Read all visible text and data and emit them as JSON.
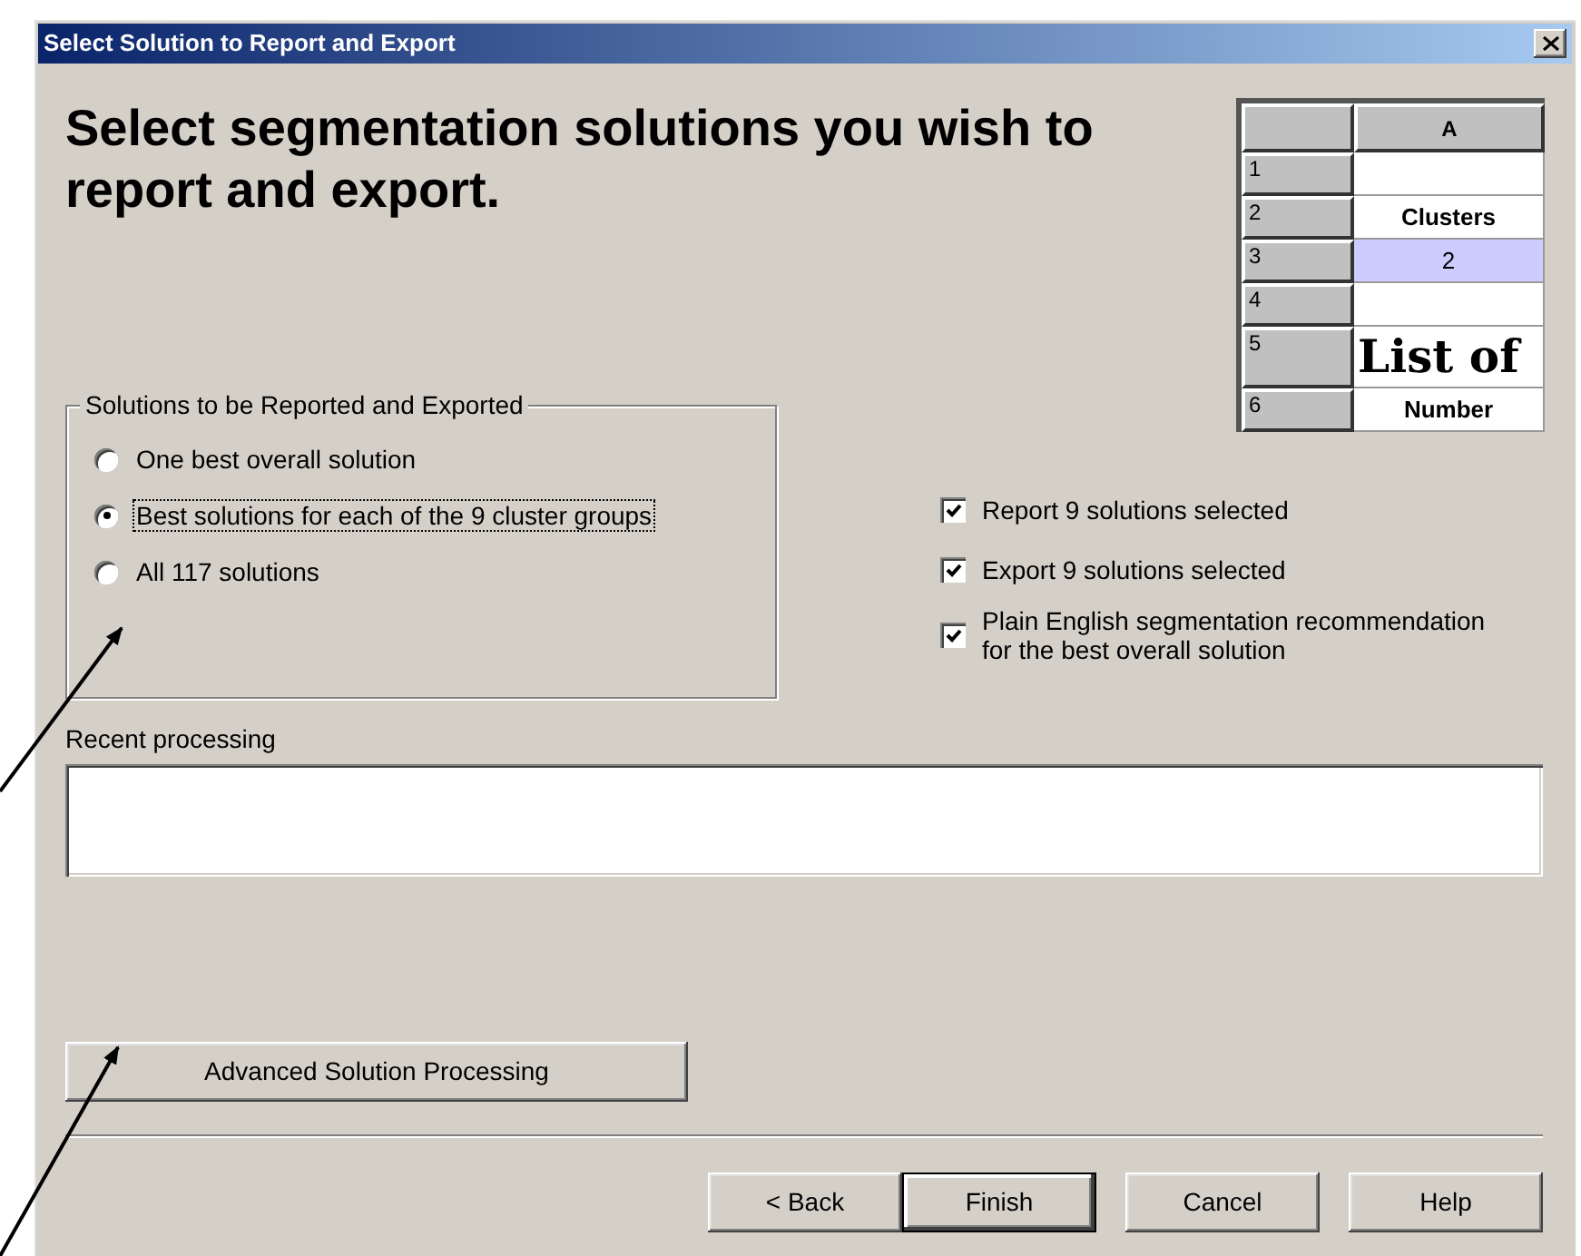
{
  "window": {
    "title": "Select Solution to Report and Export"
  },
  "heading": "Select segmentation solutions you wish to report and export.",
  "spreadsheet": {
    "column_header": "A",
    "rows": [
      {
        "number": "1",
        "selected": false
      },
      {
        "number": "2",
        "cell": "Clusters",
        "kind": "bold",
        "selected": false
      },
      {
        "number": "3",
        "cell": "2",
        "kind": "plain",
        "selected": true
      },
      {
        "number": "4",
        "selected": false
      },
      {
        "number": "5",
        "cell": "List of",
        "kind": "large",
        "selected": false
      },
      {
        "number": "6",
        "cell": "Number",
        "kind": "bold",
        "selected": false
      }
    ]
  },
  "solutions_group": {
    "title": "Solutions to be Reported and Exported",
    "options": [
      {
        "label": "One best overall solution",
        "selected": false
      },
      {
        "label": "Best solutions for each of the 9 cluster groups",
        "selected": true
      },
      {
        "label": "All 117 solutions",
        "selected": false
      }
    ]
  },
  "checkboxes": [
    {
      "label": "Report 9 solutions selected",
      "checked": true
    },
    {
      "label": "Export 9 solutions selected",
      "checked": true
    },
    {
      "label": "Plain English segmentation recommendation for the best overall solution",
      "checked": true
    }
  ],
  "recent_processing": {
    "label": "Recent processing"
  },
  "advanced_button": "Advanced Solution Processing",
  "buttons": [
    {
      "label": "< Back",
      "default": false
    },
    {
      "label": "Finish",
      "default": true
    },
    {
      "label": "Cancel",
      "default": false
    },
    {
      "label": "Help",
      "default": false
    }
  ]
}
